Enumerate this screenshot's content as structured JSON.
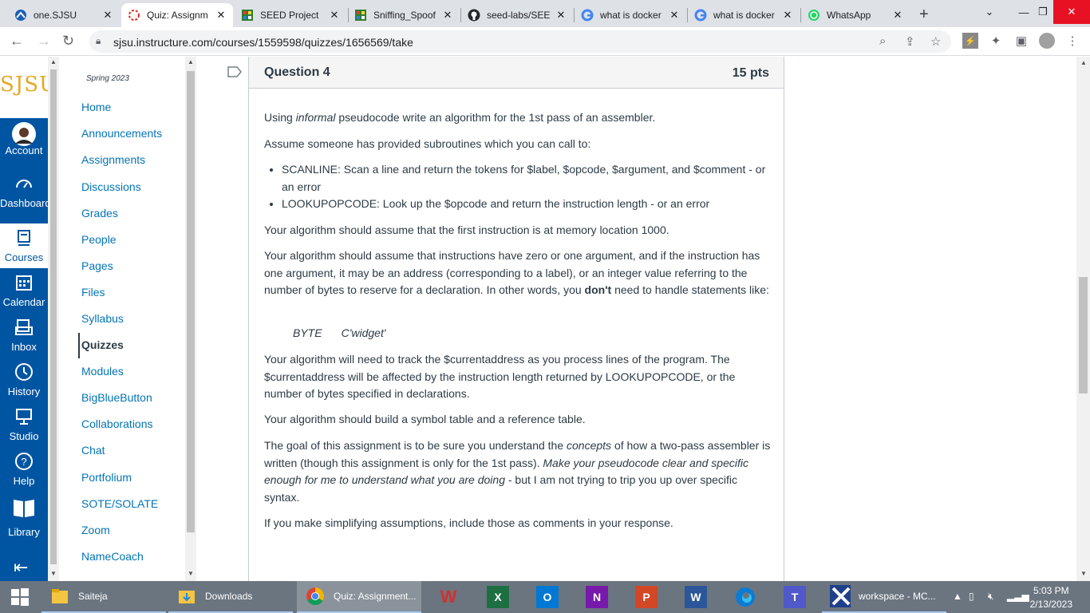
{
  "browser": {
    "tabs": [
      {
        "title": "one.SJSU",
        "icon": "one-sjsu-icon"
      },
      {
        "title": "Quiz: Assignm",
        "icon": "canvas-loading-icon"
      },
      {
        "title": "SEED Project",
        "icon": "seed-icon"
      },
      {
        "title": "Sniffing_Spoof",
        "icon": "seed-icon"
      },
      {
        "title": "seed-labs/SEE",
        "icon": "github-icon"
      },
      {
        "title": "what is docker",
        "icon": "google-icon"
      },
      {
        "title": "what is docker",
        "icon": "google-icon"
      },
      {
        "title": "WhatsApp",
        "icon": "whatsapp-icon"
      }
    ],
    "url": "sjsu.instructure.com/courses/1559598/quizzes/1656569/take"
  },
  "global_nav": {
    "logo": "SJSU",
    "items": [
      {
        "label": "Account",
        "icon": "avatar-icon"
      },
      {
        "label": "Dashboard",
        "icon": "dashboard-icon"
      },
      {
        "label": "Courses",
        "icon": "courses-icon"
      },
      {
        "label": "Calendar",
        "icon": "calendar-icon"
      },
      {
        "label": "Inbox",
        "icon": "inbox-icon"
      },
      {
        "label": "History",
        "icon": "history-icon"
      },
      {
        "label": "Studio",
        "icon": "studio-icon"
      },
      {
        "label": "Help",
        "icon": "help-icon"
      },
      {
        "label": "Library",
        "icon": "library-icon"
      }
    ]
  },
  "course_nav": {
    "term": "Spring 2023",
    "items": [
      "Home",
      "Announcements",
      "Assignments",
      "Discussions",
      "Grades",
      "People",
      "Pages",
      "Files",
      "Syllabus",
      "Quizzes",
      "Modules",
      "BigBlueButton",
      "Collaborations",
      "Chat",
      "Portfolium",
      "SOTE/SOLATE",
      "Zoom",
      "NameCoach"
    ],
    "active": "Quizzes"
  },
  "question": {
    "title": "Question 4",
    "points": "15 pts",
    "p1_a": "Using ",
    "p1_em": "informal",
    "p1_b": " pseudocode write an algorithm for the 1st pass of an assembler.",
    "p2": "Assume someone has provided subroutines which you can call to:",
    "bullet1": "SCANLINE:  Scan a line and return the tokens for $label, $opcode, $argument, and $comment - or an error",
    "bullet2": "LOOKUPOPCODE:  Look up the $opcode and return the instruction length - or an error",
    "p3": "Your algorithm should assume that the first instruction is at memory location 1000.",
    "p4_a": "Your algorithm should assume that instructions have zero or one argument, and if the instruction has one argument, it may be an address (corresponding to a label), or an integer value referring to the number of bytes to reserve for a declaration.  In other words, you ",
    "p4_strong": "don't",
    "p4_b": " need to handle statements like:",
    "code_a": "BYTE",
    "code_b": "C'widget'",
    "p5": "Your algorithm will need to track the $currentaddress as you process lines of the program.  The $currentaddress will be affected by the instruction length returned by LOOKUPOPCODE, or the number of bytes specified in declarations.",
    "p6": "Your algorithm should build a symbol table and a reference table.",
    "p7_a": " The goal of this assignment is to be sure you understand the ",
    "p7_em1": "concepts",
    "p7_b": " of how a two-pass assembler is written (though this assignment is only for the 1st pass).  ",
    "p7_em2": "Make your pseudocode clear and specific enough for me to understand what you are doing",
    "p7_c": " - but I am not trying to trip you up over specific syntax.",
    "p8": "If you make simplifying assumptions, include those as comments in your response."
  },
  "taskbar": {
    "windows": [
      {
        "label": "Saiteja"
      },
      {
        "label": "Downloads"
      },
      {
        "label": "Quiz: Assignment..."
      },
      {
        "label": "workspace - MC..."
      }
    ],
    "time": "5:03 PM",
    "date": "2/13/2023"
  },
  "colors": {
    "canvas_blue": "#0055a2",
    "link": "#0374b5",
    "sjsu_gold": "#e5a823"
  }
}
